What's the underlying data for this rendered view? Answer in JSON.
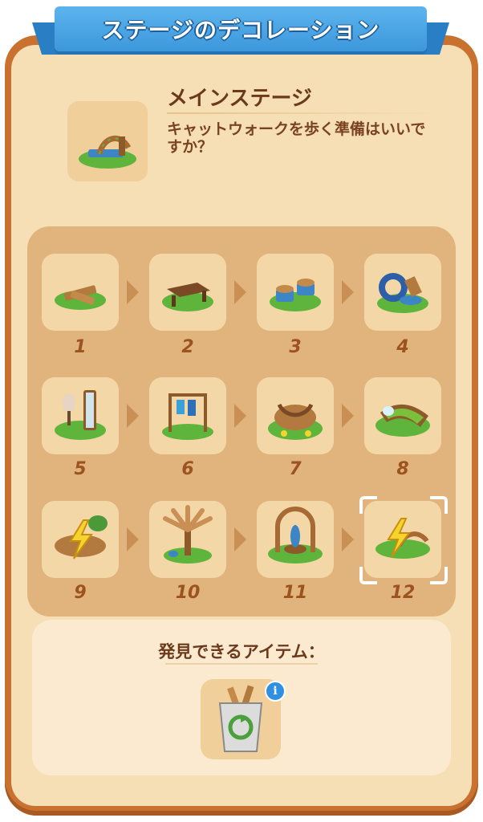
{
  "header": {
    "title": "ステージのデコレーション"
  },
  "stage": {
    "title": "メインステージ",
    "description": "キャットウォークを歩く準備はいいですか？",
    "icon": "catwalk-stage-icon"
  },
  "steps": [
    {
      "label": "1",
      "icon": "wooden-planks-icon"
    },
    {
      "label": "2",
      "icon": "bench-icon"
    },
    {
      "label": "3",
      "icon": "barrel-seats-icon"
    },
    {
      "label": "4",
      "icon": "tire-planter-icon"
    },
    {
      "label": "5",
      "icon": "mannequin-mirror-icon"
    },
    {
      "label": "6",
      "icon": "clothes-rack-icon"
    },
    {
      "label": "7",
      "icon": "round-stage-icon"
    },
    {
      "label": "8",
      "icon": "green-runway-icon"
    },
    {
      "label": "9",
      "icon": "lightning-stage-icon"
    },
    {
      "label": "10",
      "icon": "palm-tree-icon"
    },
    {
      "label": "11",
      "icon": "arch-statue-icon"
    },
    {
      "label": "12",
      "icon": "lightning-arch-icon",
      "selected": true
    }
  ],
  "items": {
    "title": "発見できるアイテム：",
    "item_icon": "recycle-bin-icon",
    "info_badge": "i"
  },
  "colors": {
    "frame": "#c9712f",
    "panel": "#f6dfb4",
    "banner": "#3d97db",
    "grid": "#e0b47c",
    "tile": "#f4d7a6",
    "number": "#9c5320",
    "text": "#6b3a1c"
  }
}
